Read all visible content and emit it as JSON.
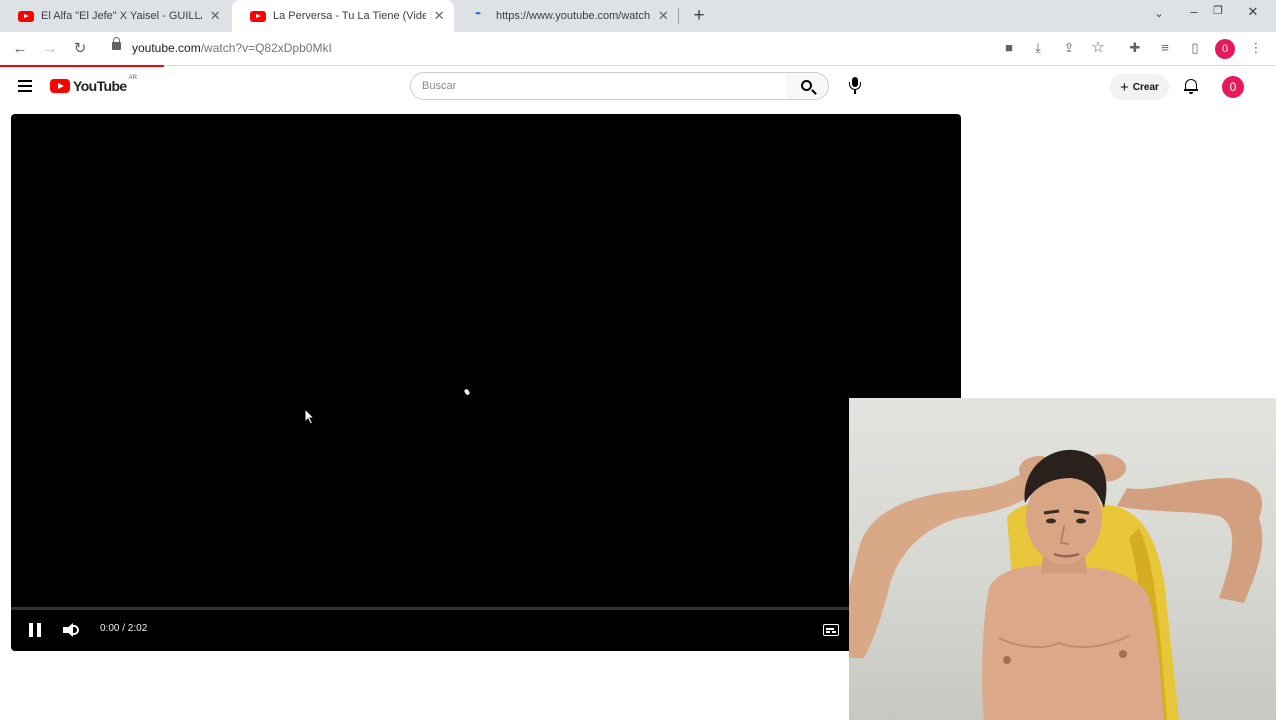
{
  "browser": {
    "tabs": [
      {
        "title": "El Alfa \"El Jefe\" X Yaisel - GUILLAO",
        "favicon": "youtube-icon",
        "active": false
      },
      {
        "title": "La Perversa - Tu La Tiene (Video Oficial)",
        "favicon": "youtube-icon",
        "active": true
      },
      {
        "title": "https://www.youtube.com/watch",
        "favicon": "loading-icon",
        "active": false
      }
    ],
    "new_tab_label": "+",
    "window_controls": {
      "minimize": "–",
      "restore": "❐",
      "close": "✕"
    },
    "url_host": "youtube.com",
    "url_path": "/watch?v=Q82xDpb0MkI",
    "profile_initial": "0",
    "accent_color": "#e6195a"
  },
  "youtube": {
    "logo_text": "YouTube",
    "country_code": "AR",
    "search_placeholder": "Buscar",
    "create_label": "Crear",
    "avatar_initial": "0",
    "brand_color": "#ff0000"
  },
  "player": {
    "time_current": "0:00",
    "time_total": "2:02",
    "time_display": "0:00 / 2:02",
    "progress_fraction": 0.0,
    "state": "playing"
  }
}
